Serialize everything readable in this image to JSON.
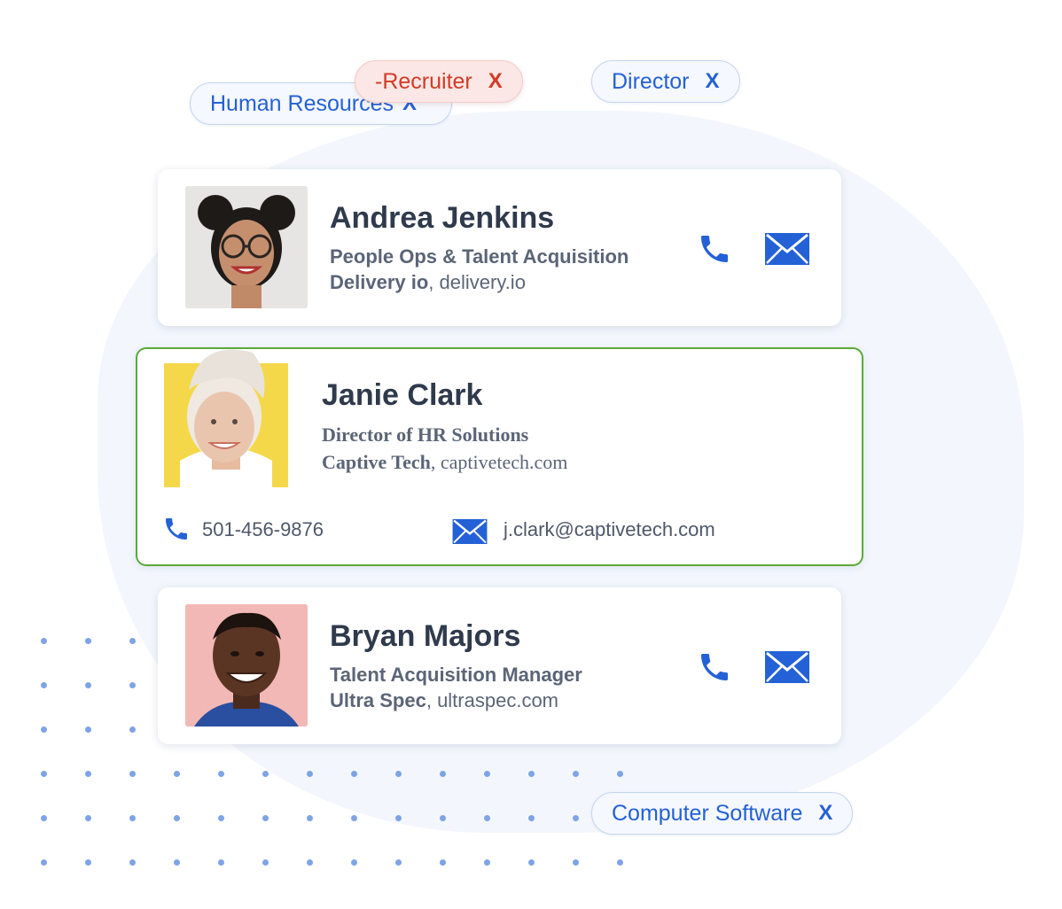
{
  "filters": {
    "human_resources": "Human Resources",
    "recruiter": "-Recruiter",
    "director": "Director",
    "computer_software": "Computer Software",
    "remove_glyph": "X"
  },
  "contacts": [
    {
      "name": "Andrea Jenkins",
      "title": "People Ops & Talent Acquisition",
      "company": "Delivery io",
      "domain": "delivery.io"
    },
    {
      "name": "Janie Clark",
      "title": "Director of HR Solutions",
      "company": "Captive Tech",
      "domain": "captivetech.com",
      "phone": "501-456-9876",
      "email": "j.clark@captivetech.com"
    },
    {
      "name": "Bryan Majors",
      "title": "Talent Acquisition Manager",
      "company": "Ultra Spec",
      "domain": "ultraspec.com"
    }
  ],
  "icons": {
    "phone": "phone-icon",
    "email": "mail-icon"
  },
  "colors": {
    "accent_blue": "#2461d6",
    "remove_red": "#d23b25",
    "selected_green": "#5aa93a",
    "heading": "#2f3a4c",
    "subtext": "#5b6577"
  }
}
